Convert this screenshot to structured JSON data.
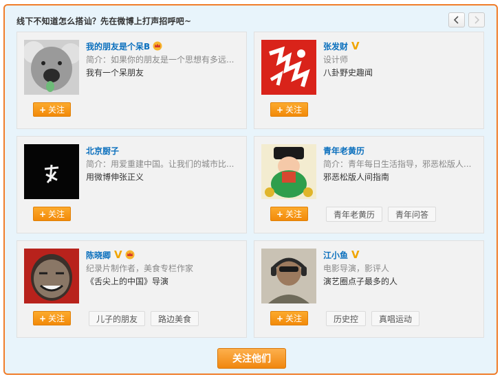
{
  "header": {
    "title": "线下不知道怎么搭讪？先在微博上打声招呼吧~",
    "prev_icon": "chevron-left-icon",
    "next_icon": "chevron-right-icon"
  },
  "colors": {
    "accent_orange": "#f07c28",
    "name_blue": "#0a6fbd",
    "panel_bg": "#e8f4fb"
  },
  "follow_label": "关注",
  "follow_all_label": "关注他们",
  "users": [
    {
      "name": "我的朋友是个呆B",
      "badges": [
        "crown"
      ],
      "intro": "简介：如果你的朋友是一个思想有多远...",
      "desc": "我有一个呆朋友",
      "tags": []
    },
    {
      "name": "张发财",
      "badges": [
        "v"
      ],
      "intro": "设计师",
      "desc": "八卦野史趣闻",
      "tags": []
    },
    {
      "name": "北京厨子",
      "badges": [],
      "intro": "简介：用爱重建中国。让我们的城市比...",
      "desc": "用微博伸张正义",
      "tags": []
    },
    {
      "name": "青年老黄历",
      "badges": [],
      "intro": "简介：青年每日生活指导，邪恶松版人...",
      "desc": "邪恶松版人间指南",
      "tags": [
        "青年老黄历",
        "青年问答"
      ]
    },
    {
      "name": "陈晓卿",
      "badges": [
        "v",
        "crown"
      ],
      "intro": "纪录片制作者，美食专栏作家",
      "desc": "《舌尖上的中国》导演",
      "tags": [
        "儿子的朋友",
        "路边美食"
      ]
    },
    {
      "name": "江小鱼",
      "badges": [
        "v"
      ],
      "intro": "电影导演，影评人",
      "desc": "演艺圈点子最多的人",
      "tags": [
        "历史控",
        "真唱运动"
      ]
    }
  ]
}
